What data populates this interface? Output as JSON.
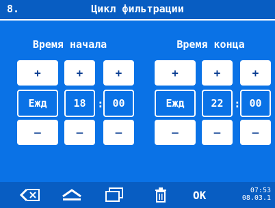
{
  "header": {
    "number": "8.",
    "title": "Цикл фильтрации"
  },
  "start": {
    "label": "Время начала",
    "plus": "+",
    "minus": "–",
    "day": "Ежд",
    "hour": "18",
    "minute": "00",
    "sep": ":"
  },
  "end": {
    "label": "Время конца",
    "plus": "+",
    "minus": "–",
    "day": "Ежд",
    "hour": "22",
    "minute": "00",
    "sep": ":"
  },
  "footer": {
    "ok_label": "OK",
    "time": "07:53",
    "date": "08.03.1",
    "icons": [
      "back-icon",
      "home-icon",
      "windows-icon",
      "trash-icon"
    ]
  },
  "colors": {
    "background": "#0a72e6",
    "bar": "#085dc2",
    "button": "#ffffff",
    "button_text": "#0a3d91"
  }
}
